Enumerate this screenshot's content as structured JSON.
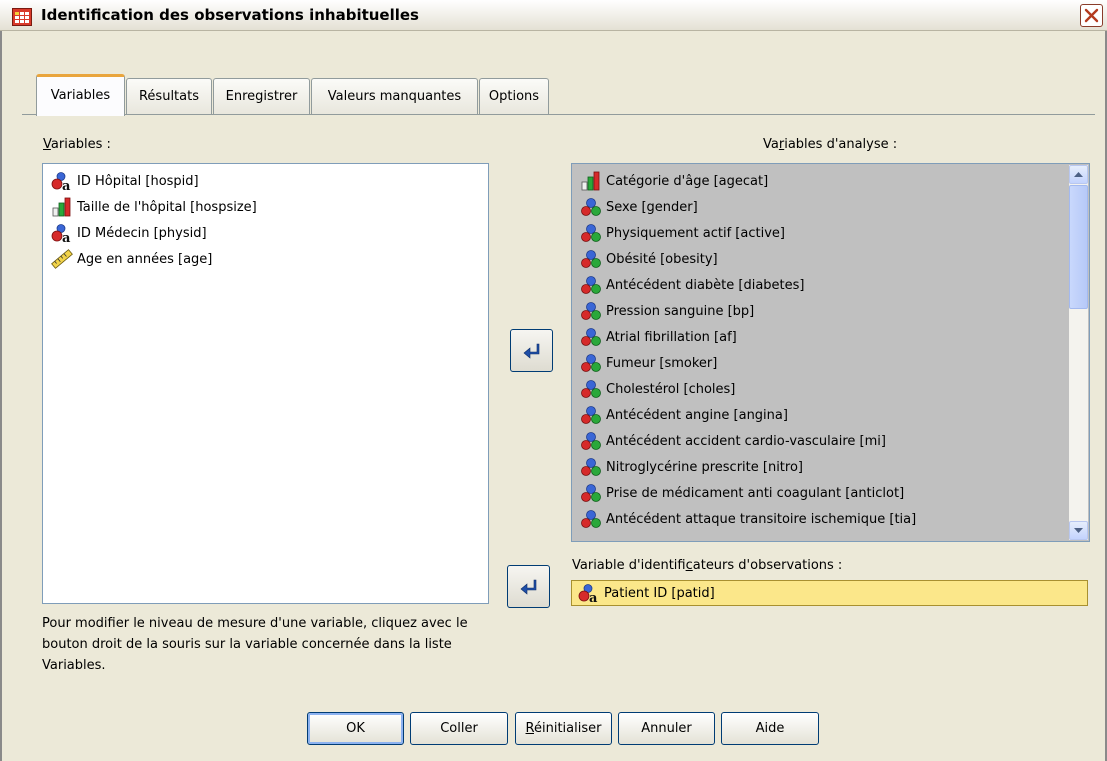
{
  "window": {
    "title": "Identification des observations inhabituelles"
  },
  "tabs": [
    {
      "label": "Variables",
      "active": true
    },
    {
      "label": "Résultats"
    },
    {
      "label": "Enregistrer"
    },
    {
      "label": "Valeurs manquantes"
    },
    {
      "label": "Options"
    }
  ],
  "source": {
    "label_first": "V",
    "label_rest": "ariables :",
    "items": [
      {
        "label": "ID Hôpital [hospid]",
        "icon": "nominal-string-icon"
      },
      {
        "label": "Taille de l'hôpital [hospsize]",
        "icon": "ordinal-icon"
      },
      {
        "label": "ID Médecin [physid]",
        "icon": "nominal-string-icon"
      },
      {
        "label": "Age en années [age]",
        "icon": "scale-ruler-icon"
      }
    ]
  },
  "analysis": {
    "label_first": "Va",
    "label_u": "r",
    "label_rest": "iables d'analyse :",
    "items": [
      {
        "label": "Catégorie d'âge [agecat]",
        "icon": "ordinal-icon"
      },
      {
        "label": "Sexe [gender]",
        "icon": "nominal-icon"
      },
      {
        "label": "Physiquement actif [active]",
        "icon": "nominal-icon"
      },
      {
        "label": "Obésité [obesity]",
        "icon": "nominal-icon"
      },
      {
        "label": "Antécédent diabète [diabetes]",
        "icon": "nominal-icon"
      },
      {
        "label": "Pression sanguine [bp]",
        "icon": "nominal-icon"
      },
      {
        "label": "Atrial fibrillation [af]",
        "icon": "nominal-icon"
      },
      {
        "label": "Fumeur [smoker]",
        "icon": "nominal-icon"
      },
      {
        "label": "Cholestérol [choles]",
        "icon": "nominal-icon"
      },
      {
        "label": "Antécédent angine [angina]",
        "icon": "nominal-icon"
      },
      {
        "label": "Antécédent accident cardio-vasculaire [mi]",
        "icon": "nominal-icon"
      },
      {
        "label": "Nitroglycérine prescrite [nitro]",
        "icon": "nominal-icon"
      },
      {
        "label": "Prise de médicament anti coagulant [anticlot]",
        "icon": "nominal-icon"
      },
      {
        "label": "Antécédent attaque transitoire ischemique [tia]",
        "icon": "nominal-icon"
      }
    ]
  },
  "case_id": {
    "label_first": "Variable d'identifi",
    "label_u": "c",
    "label_rest": "ateurs d'observations :",
    "value": "Patient ID [patid]",
    "icon": "nominal-string-icon"
  },
  "hint": "Pour modifier le niveau de mesure d'une variable, cliquez avec le bouton droit de la souris sur la variable concernée dans la liste Variables.",
  "buttons": {
    "ok": "OK",
    "paste": "Coller",
    "reset_u": "R",
    "reset_rest": "éinitialiser",
    "cancel": "Annuler",
    "help": "Aide"
  },
  "colors": {
    "id_field": "#fbe78a",
    "tab_accent": "#e9a53d"
  }
}
